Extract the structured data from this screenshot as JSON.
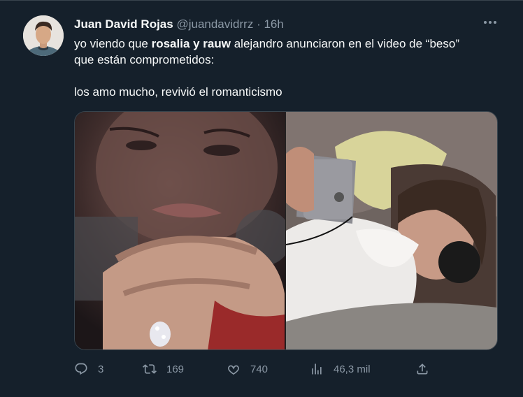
{
  "tweet": {
    "author_name": "Juan David Rojas",
    "handle": "@juandavidrrz",
    "separator": "·",
    "time": "16h",
    "text_line1_a": "yo viendo que ",
    "text_line1_b": "rosalia y rauw",
    "text_line1_c": " alejandro anunciaron en el video de “beso”",
    "text_line2": "que están comprometidos:",
    "text_line3": "los amo mucho, revivió el romanticismo"
  },
  "actions": {
    "replies": "3",
    "retweets": "169",
    "likes": "740",
    "views": "46,3 mil"
  },
  "icons": [
    "more-icon",
    "reply-icon",
    "retweet-icon",
    "like-icon",
    "views-icon",
    "share-icon"
  ],
  "colors": {
    "background": "#15202b",
    "text": "#f7f9f9",
    "secondary": "#8b98a5",
    "border": "#38444d"
  }
}
